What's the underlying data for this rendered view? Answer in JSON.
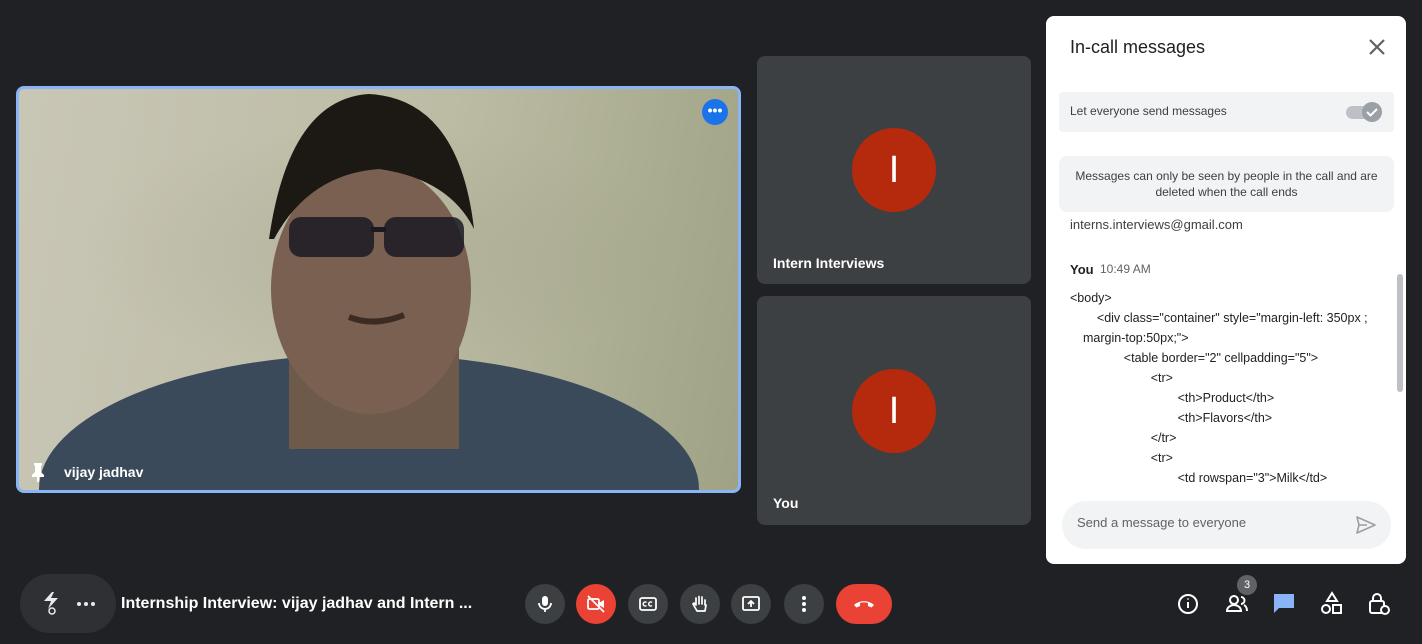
{
  "tiles": {
    "main": {
      "name": "vijay jadhav"
    },
    "side1": {
      "name": "Intern Interviews",
      "avatar_letter": "I"
    },
    "side2": {
      "name": "You",
      "avatar_letter": "I"
    }
  },
  "chat": {
    "title": "In-call messages",
    "permission_label": "Let everyone send messages",
    "permission_on": true,
    "notice": "Messages can only be seen by people in the call and are deleted when the call ends",
    "partial_line": "interns.interviews@gmail.com",
    "message": {
      "sender": "You",
      "time": "10:49 AM",
      "lines": [
        "<body>",
        "    <div class=\"container\" style=\"margin-left: 350px ; margin-top:50px;\">",
        "        <table border=\"2\" cellpadding=\"5\">",
        "            <tr>",
        "                <th>Product</th>",
        "                <th>Flavors</th>",
        "            </tr>",
        "            <tr>",
        "                <td rowspan=\"3\">Milk</td>"
      ]
    },
    "input_placeholder": "Send a message to everyone"
  },
  "bottom_bar": {
    "meeting_title": "Internship Interview: vijay jadhav and Intern ...",
    "people_count": "3"
  },
  "colors": {
    "background": "#202124",
    "tile": "#3c4043",
    "accent": "#1a73e8",
    "danger": "#ea4335",
    "avatar": "#b5290c"
  }
}
